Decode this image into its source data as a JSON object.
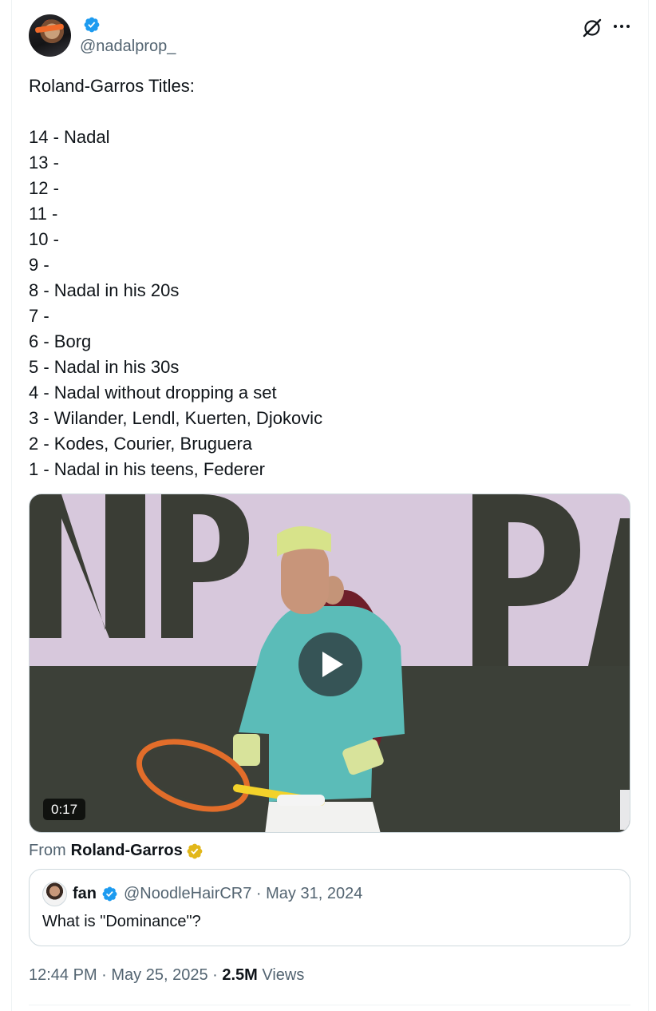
{
  "author": {
    "handle": "@nadalprop_",
    "verified": true,
    "avatar_icon": "profile-photo"
  },
  "tweet": {
    "text": "Roland-Garros Titles:\n\n14 - Nadal\n13 - \n12 - \n11 - \n10 - \n9 - \n8 - Nadal in his 20s\n7 - \n6 - Borg\n5 - Nadal in his 30s\n4 - Nadal without dropping a set\n3 - Wilander, Lendl, Kuerten, Djokovic\n2 - Kodes, Courier, Bruguera\n1 - Nadal in his teens, Federer"
  },
  "media": {
    "type": "video",
    "duration": "0:17",
    "play_icon": "play-icon"
  },
  "source": {
    "prefix": "From",
    "name": "Roland-Garros",
    "badge_color": "#e2b719"
  },
  "quote": {
    "name": "fan",
    "handle_date": "@NoodleHairCR7 · May 31, 2024",
    "text": "What is \"Dominance\"?"
  },
  "meta": {
    "timestamp": "12:44 PM · May 25, 2025 · ",
    "views_count": "2.5M",
    "views_label": " Views"
  },
  "colors": {
    "verified_blue": "#1d9bf0",
    "secondary_text": "#536471",
    "primary_text": "#0f1419"
  }
}
